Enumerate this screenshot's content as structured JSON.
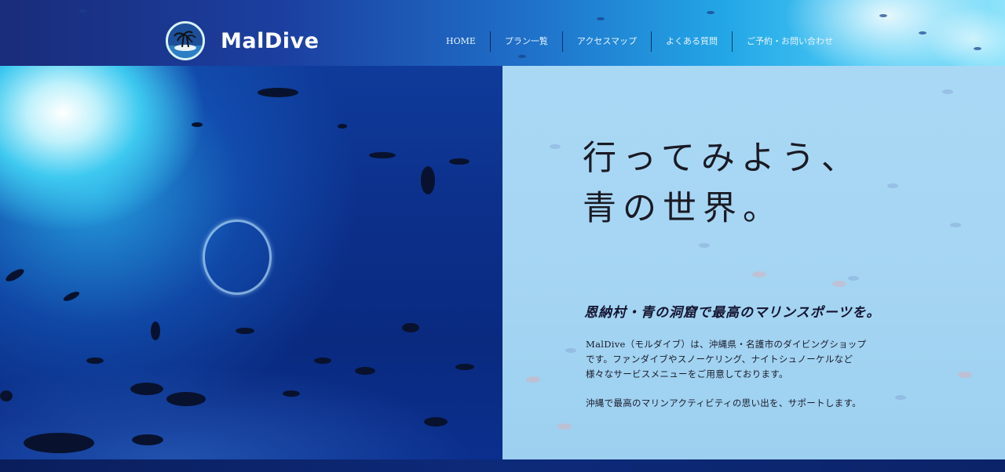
{
  "brand": {
    "name": "MalDive",
    "logo_icon": "palm-island-icon"
  },
  "nav": {
    "items": [
      {
        "label": "HOME"
      },
      {
        "label": "プラン一覧"
      },
      {
        "label": "アクセスマップ"
      },
      {
        "label": "よくある質問"
      },
      {
        "label": "ご予約・お問い合わせ"
      }
    ]
  },
  "hero": {
    "headline_line1": "行ってみよう、",
    "headline_line2": "青の世界。",
    "subheading": "恩納村・青の洞窟で最高のマリンスポーツを。",
    "body_line1": "MalDive（モルダイブ）は、沖縄県・名護市のダイビングショップ",
    "body_line2": "です。ファンダイブやスノーケリング、ナイトシュノーケルなど",
    "body_line3": "様々なサービスメニューをご用意しております。",
    "body_line4": "沖縄で最高のマリンアクティビティの思い出を、サポートします。"
  },
  "colors": {
    "deep_blue": "#0b2f8e",
    "light_panel": "#a6d6f3",
    "text_dark": "#1a1a24"
  }
}
